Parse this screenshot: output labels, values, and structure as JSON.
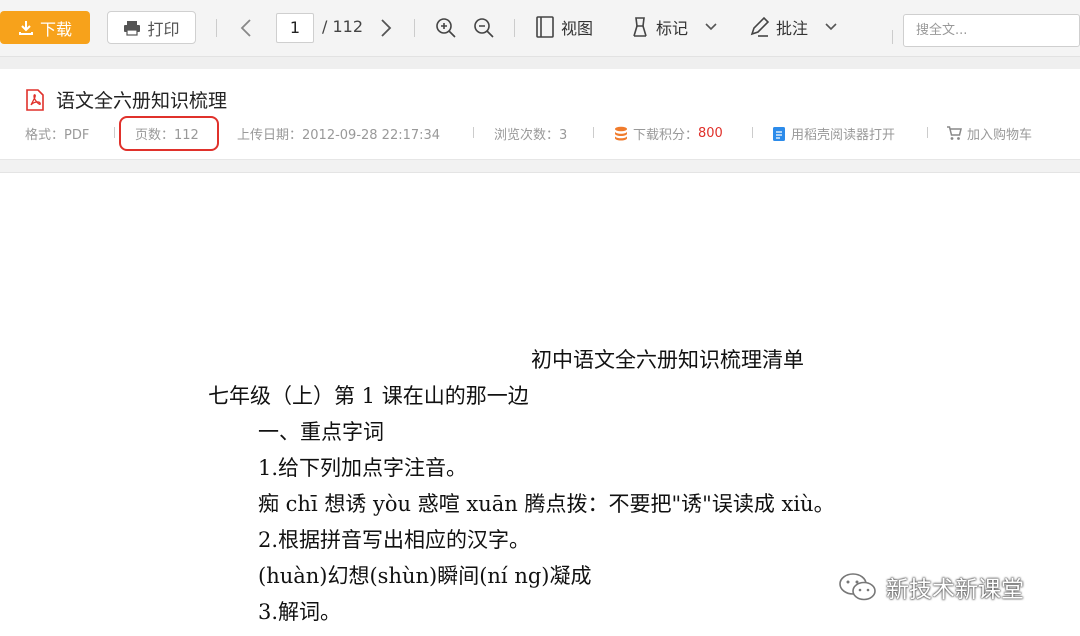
{
  "toolbar": {
    "download_label": "下载",
    "print_label": "打印",
    "current_page": "1",
    "total_pages": "/ 112",
    "view_label": "视图",
    "mark_label": "标记",
    "annotate_label": "批注",
    "search_placeholder": "搜全文..."
  },
  "doc_info": {
    "title": "语文全六册知识梳理",
    "format": "格式：PDF",
    "pages": "页数：112",
    "upload_date": "上传日期：2012-09-28 22:17:34",
    "views": "浏览次数：3",
    "points_label": "下载积分：",
    "points_value": "800",
    "open_with": "用稻壳阅读器打开",
    "add_cart": "加入购物车"
  },
  "document": {
    "heading": "初中语文全六册知识梳理清单",
    "lesson": "七年级（上）第 1 课在山的那一边",
    "section": "一、重点字词",
    "q1": "1.给下列加点字注音。",
    "q1_answer": "痴 chī 想诱 yòu 惑喧 xuān 腾点拨：不要把\"诱\"误读成 xiù。",
    "q2": "2.根据拼音写出相应的汉字。",
    "q2_answer": "(huàn)幻想(shùn)瞬间(ní ng)凝成",
    "q3": "3.解词。"
  },
  "watermark": {
    "text": "新技术新课堂"
  },
  "colors": {
    "download": "#f7a21b",
    "highlight": "#e0312b",
    "points": "#e0312b",
    "pdf": "#e0312b"
  }
}
